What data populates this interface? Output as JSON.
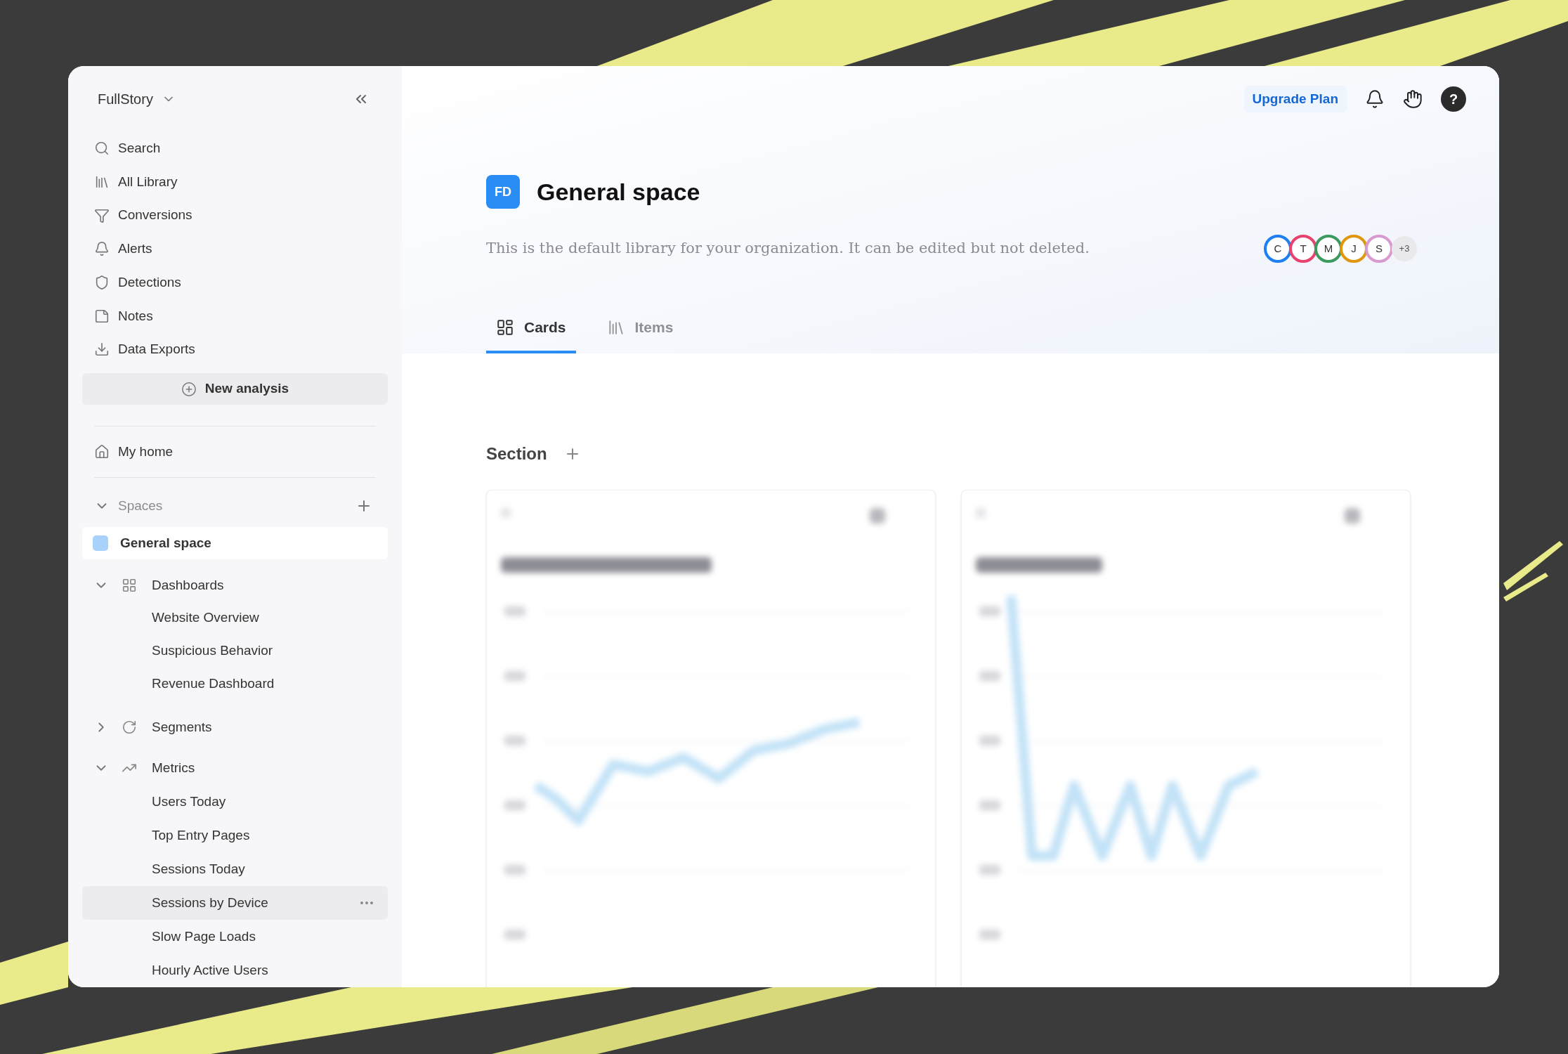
{
  "sidebar": {
    "workspace": "FullStory",
    "nav": [
      {
        "label": "Search"
      },
      {
        "label": "All Library"
      },
      {
        "label": "Conversions"
      },
      {
        "label": "Alerts"
      },
      {
        "label": "Detections"
      },
      {
        "label": "Notes"
      },
      {
        "label": "Data Exports"
      }
    ],
    "new_analysis": "New analysis",
    "home": "My home",
    "spaces": {
      "label": "Spaces",
      "expanded": true,
      "items": [
        {
          "label": "General space",
          "selected": true
        }
      ]
    },
    "tree": [
      {
        "label": "Dashboards",
        "expanded": true,
        "children": [
          {
            "label": "Website Overview",
            "selected": false
          },
          {
            "label": "Suspicious Behavior",
            "selected": false
          },
          {
            "label": "Revenue Dashboard",
            "selected": false
          }
        ]
      },
      {
        "label": "Segments",
        "expanded": false
      },
      {
        "label": "Metrics",
        "expanded": true,
        "children": [
          {
            "label": "Users Today",
            "selected": false
          },
          {
            "label": "Top Entry Pages",
            "selected": false
          },
          {
            "label": "Sessions Today",
            "selected": false
          },
          {
            "label": "Sessions by Device",
            "selected": true
          },
          {
            "label": "Slow Page Loads",
            "selected": false
          },
          {
            "label": "Hourly Active Users",
            "selected": false
          }
        ]
      }
    ]
  },
  "header": {
    "upgrade": "Upgrade Plan",
    "help": "?"
  },
  "space": {
    "badge": "FD",
    "title": "General space",
    "description": "This is the default library for your organization. It can be edited but not deleted.",
    "members": [
      {
        "initial": "C",
        "color": "#1e7ff0"
      },
      {
        "initial": "T",
        "color": "#e8426e"
      },
      {
        "initial": "M",
        "color": "#3d9a5f"
      },
      {
        "initial": "J",
        "color": "#e0960f"
      },
      {
        "initial": "S",
        "color": "#d79bd0"
      }
    ],
    "more_members": "+3"
  },
  "tabs": [
    {
      "label": "Cards",
      "selected": true
    },
    {
      "label": "Items",
      "selected": false
    }
  ],
  "section": {
    "title": "Section"
  }
}
